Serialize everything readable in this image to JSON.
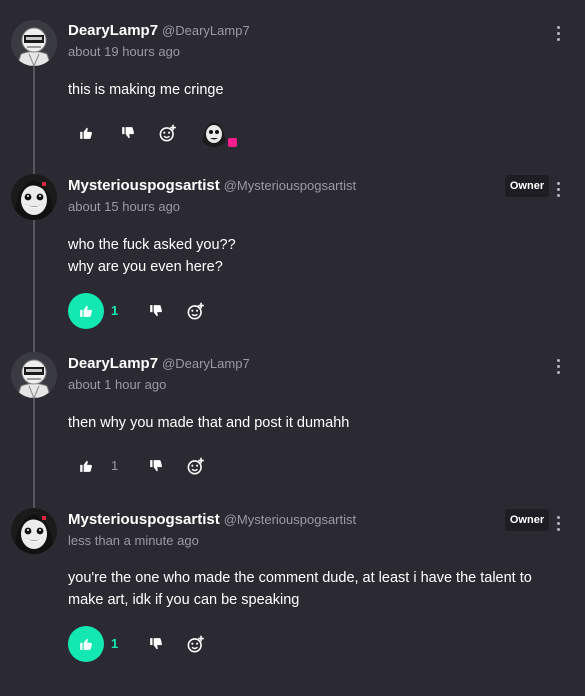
{
  "comments": [
    {
      "username": "DearyLamp7",
      "handle": "@DearyLamp7",
      "time": "about 19 hours ago",
      "text": [
        "this is making me cringe"
      ],
      "owner_badge": "",
      "like_count": "",
      "liked": false,
      "reaction_user": true,
      "avatar": "robot-avatar"
    },
    {
      "username": "Mysteriouspogsartist",
      "handle": "@Mysteriouspogsartist",
      "time": "about 15 hours ago",
      "text": [
        "who the fuck asked you??",
        "why are you even here?"
      ],
      "owner_badge": "Owner",
      "like_count": "1",
      "liked": true,
      "avatar": "grin-face-avatar"
    },
    {
      "username": "DearyLamp7",
      "handle": "@DearyLamp7",
      "time": "about 1 hour ago",
      "text": [
        "then why you made that and post it dumahh"
      ],
      "owner_badge": "",
      "like_count": "1",
      "liked": false,
      "avatar": "robot-avatar"
    },
    {
      "username": "Mysteriouspogsartist",
      "handle": "@Mysteriouspogsartist",
      "time": "less than a minute ago",
      "text": [
        "you're the one who made the comment dude, at least i have the talent to make art, idk if you can be speaking"
      ],
      "owner_badge": "Owner",
      "like_count": "1",
      "liked": true,
      "avatar": "grin-face-avatar"
    }
  ],
  "colors": {
    "background": "#2b2a33",
    "accent": "#13e8b3",
    "muted_text": "#9a9aa3",
    "badge_bg": "#1e1d24",
    "reaction_dot": "#ff1e8c"
  },
  "icons": [
    "thumbs-up-icon",
    "thumbs-down-icon",
    "add-reaction-icon",
    "more-options-icon"
  ]
}
